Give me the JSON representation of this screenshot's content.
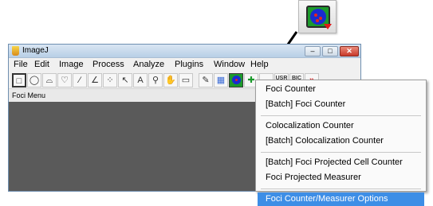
{
  "window": {
    "title": "ImageJ",
    "minimize_glyph": "–",
    "maximize_glyph": "□",
    "close_glyph": "✕"
  },
  "menubar": [
    "File",
    "Edit",
    "Image",
    "Process",
    "Analyze",
    "Plugins",
    "Window",
    "Help"
  ],
  "toolbar": {
    "tools": [
      {
        "name": "rectangle-tool-icon",
        "glyph": "□"
      },
      {
        "name": "oval-tool-icon",
        "glyph": "◯"
      },
      {
        "name": "polygon-tool-icon",
        "glyph": "⌓"
      },
      {
        "name": "freehand-tool-icon",
        "glyph": "♡"
      },
      {
        "name": "line-tool-icon",
        "glyph": "∕"
      },
      {
        "name": "angle-tool-icon",
        "glyph": "∠"
      },
      {
        "name": "point-tool-icon",
        "glyph": "⁘"
      },
      {
        "name": "wand-tool-icon",
        "glyph": "↖"
      },
      {
        "name": "text-tool-icon",
        "glyph": "A"
      },
      {
        "name": "magnifier-tool-icon",
        "glyph": "⚲"
      },
      {
        "name": "scroll-tool-icon",
        "glyph": "✋"
      },
      {
        "name": "color-picker-tool-icon",
        "glyph": "▭"
      },
      {
        "name": "edit-tool-icon",
        "glyph": "✎"
      },
      {
        "name": "lut-tool-icon",
        "glyph": "▦"
      },
      {
        "name": "foci-menu-tool-icon",
        "glyph": ""
      },
      {
        "name": "plus-tool-icon",
        "glyph": "✚"
      },
      {
        "name": "bar-tool-icon",
        "glyph": "▬"
      },
      {
        "name": "user-tool-icon",
        "glyph": "USR"
      },
      {
        "name": "bic-tool-icon",
        "glyph": "BIC"
      },
      {
        "name": "more-tools-icon",
        "glyph": "»"
      }
    ]
  },
  "status": "Foci Menu",
  "dropdown": {
    "items": [
      {
        "label": "Foci Counter",
        "selected": false
      },
      {
        "label": "[Batch] Foci Counter",
        "selected": false
      },
      {
        "separator": true
      },
      {
        "label": "Colocalization Counter",
        "selected": false
      },
      {
        "label": "[Batch] Colocalization Counter",
        "selected": false
      },
      {
        "separator": true
      },
      {
        "label": "[Batch] Foci Projected Cell Counter",
        "selected": false
      },
      {
        "label": "Foci Projected Measurer",
        "selected": false
      },
      {
        "separator": true
      },
      {
        "label": "Foci Counter/Measurer Options",
        "selected": true
      }
    ]
  },
  "colors": {
    "accent_selected": "#3d8ee6",
    "workspace": "#5a5a5a",
    "foci_green": "#1c9a2c",
    "foci_blue": "#1a2bd0",
    "foci_red": "#e8241c"
  }
}
